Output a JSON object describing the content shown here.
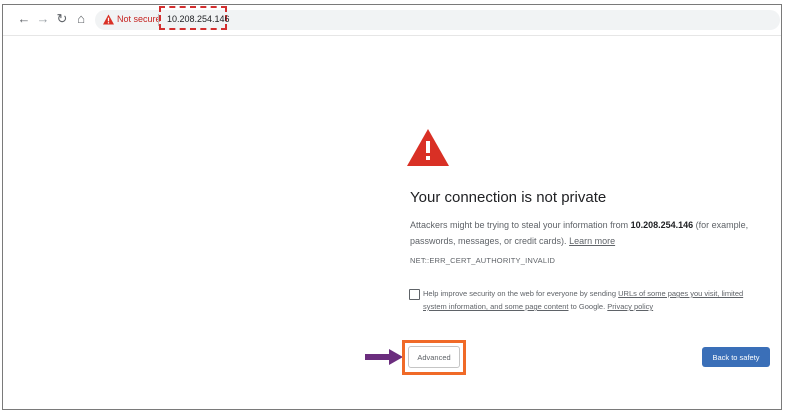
{
  "browser": {
    "security_label": "Not secure",
    "url": "10.208.254.146",
    "icons": [
      "back-icon",
      "forward-icon",
      "reload-icon",
      "home-icon",
      "warning-icon"
    ]
  },
  "page": {
    "heading": "Your connection is not private",
    "intro_before": "Attackers might be trying to steal your information from ",
    "host": "10.208.254.146",
    "intro_after": " (for example, passwords, messages, or credit cards). ",
    "learn_more": "Learn more",
    "error_code": "NET::ERR_CERT_AUTHORITY_INVALID",
    "checkbox_prefix": "Help improve security on the web for everyone by sending ",
    "checkbox_link": "URLs of some pages you visit, limited system information, and some page content",
    "checkbox_suffix": " to Google. ",
    "privacy_link": "Privacy policy",
    "advanced_label": "Advanced",
    "back_label": "Back to safety"
  },
  "colors": {
    "warning_red": "#d93025",
    "highlight_dashed": "#d32f2f",
    "advanced_frame": "#f06a28",
    "arrow": "#6b2d7e",
    "primary_button": "#3a6fb8"
  }
}
